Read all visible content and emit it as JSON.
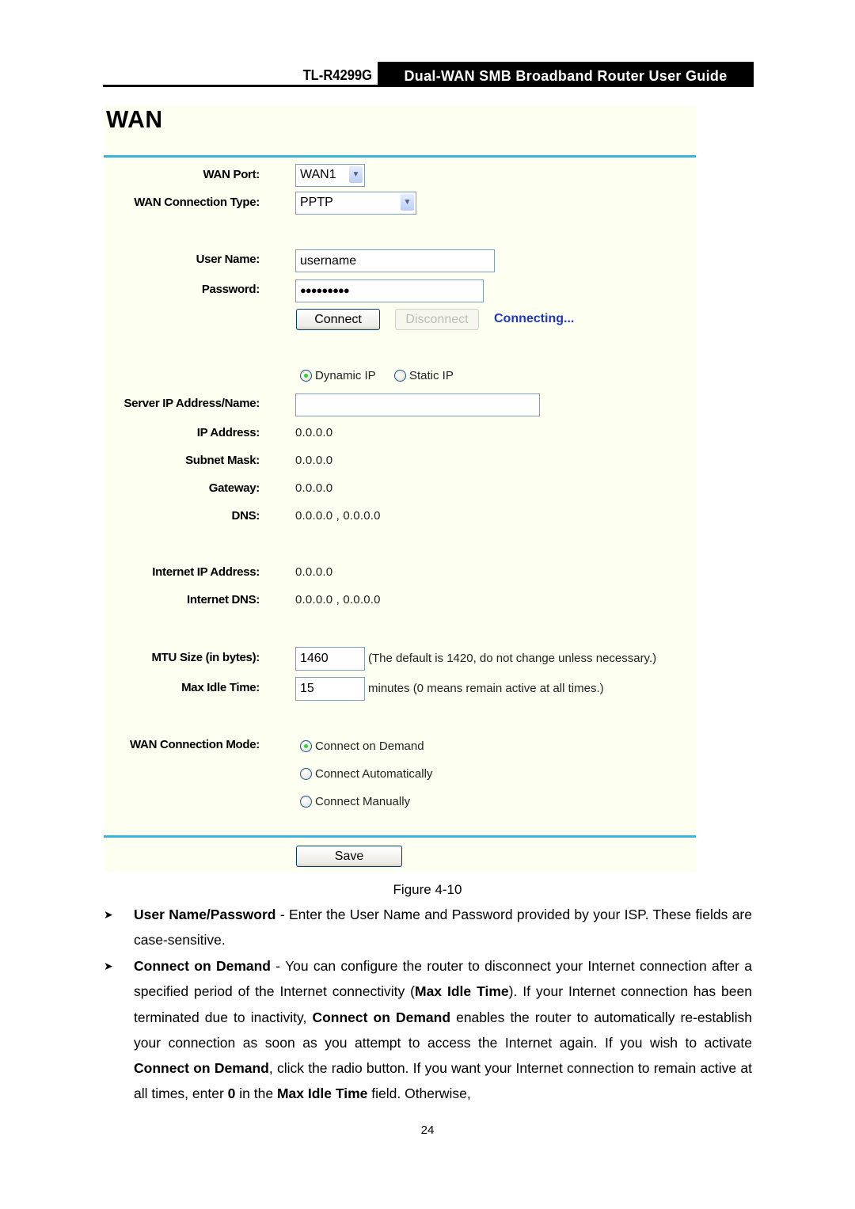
{
  "header": {
    "model": "TL-R4299G",
    "guide_title": "Dual-WAN SMB Broadband Router User Guide"
  },
  "panel": {
    "title": "WAN",
    "accent_color": "#3ab5d9",
    "background_color": "#fdfff0",
    "wan_port": {
      "label": "WAN Port:",
      "selected": "WAN1"
    },
    "connection_type": {
      "label": "WAN Connection Type:",
      "selected": "PPTP"
    },
    "user_name": {
      "label": "User Name:",
      "value": "username"
    },
    "password": {
      "label": "Password:",
      "value": "●●●●●●●●●"
    },
    "connect_button": "Connect",
    "disconnect_button": "Disconnect",
    "connection_status": "Connecting...",
    "ip_mode": {
      "options": [
        {
          "label": "Dynamic IP",
          "selected": true
        },
        {
          "label": "Static IP",
          "selected": false
        }
      ]
    },
    "server": {
      "label": "Server IP Address/Name:",
      "value": ""
    },
    "ip_address": {
      "label": "IP Address:",
      "value": "0.0.0.0"
    },
    "subnet_mask": {
      "label": "Subnet Mask:",
      "value": "0.0.0.0"
    },
    "gateway": {
      "label": "Gateway:",
      "value": "0.0.0.0"
    },
    "dns": {
      "label": "DNS:",
      "value": "0.0.0.0 , 0.0.0.0"
    },
    "internet_ip": {
      "label": "Internet IP Address:",
      "value": "0.0.0.0"
    },
    "internet_dns": {
      "label": "Internet DNS:",
      "value": "0.0.0.0 , 0.0.0.0"
    },
    "mtu": {
      "label": "MTU Size (in bytes):",
      "value": "1460",
      "hint": "(The default is 1420, do not change unless necessary.)"
    },
    "max_idle": {
      "label": "Max Idle Time:",
      "value": "15",
      "hint": "minutes (0 means remain active at all times.)"
    },
    "connection_mode": {
      "label": "WAN Connection Mode:",
      "options": [
        {
          "label": "Connect on Demand",
          "selected": true
        },
        {
          "label": "Connect Automatically",
          "selected": false
        },
        {
          "label": "Connect Manually",
          "selected": false
        }
      ]
    },
    "save_button": "Save"
  },
  "document": {
    "figure_caption": "Figure 4-10",
    "bullets": [
      {
        "term": "User Name/Password",
        "text": " - Enter the User Name and Password provided by your ISP. These fields are case-sensitive."
      },
      {
        "term": "Connect on Demand",
        "segments": [
          " - You can configure the router to disconnect your Internet connection after a specified period of the Internet connectivity (",
          "Max Idle Time",
          "). If your Internet connection has been terminated due to inactivity, ",
          "Connect on Demand",
          " enables the router to automatically re-establish your connection as soon as you attempt to access the Internet again. If you wish to activate ",
          "Connect on Demand",
          ", click the radio button. If you want your Internet connection to remain active at all times, enter ",
          "0",
          " in the ",
          "Max Idle Time",
          " field. Otherwise,"
        ]
      }
    ],
    "page_number": "24"
  }
}
